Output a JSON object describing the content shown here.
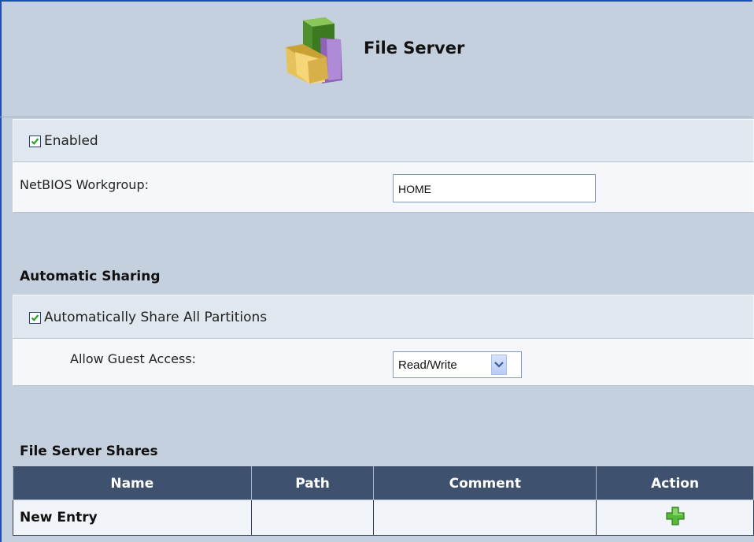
{
  "header": {
    "title": "File Server",
    "icon": "file-server-folder-icon"
  },
  "enabled": {
    "label": "Enabled",
    "checked": true
  },
  "netbios": {
    "label": "NetBIOS Workgroup:",
    "value": "HOME"
  },
  "automatic_sharing": {
    "title": "Automatic Sharing",
    "share_all": {
      "label": "Automatically Share All Partitions",
      "checked": true
    },
    "guest_access": {
      "label": "Allow Guest Access:",
      "value": "Read/Write"
    }
  },
  "shares": {
    "title": "File Server Shares",
    "columns": [
      "Name",
      "Path",
      "Comment",
      "Action"
    ],
    "new_entry": "New Entry",
    "add_icon": "add-plus-icon"
  },
  "colors": {
    "page_bg": "#c5d0de",
    "table_header_bg": "#3e5270",
    "accent_border": "#1a4fb3",
    "check_green": "#2c9c2c",
    "add_green": "#57b93a"
  }
}
